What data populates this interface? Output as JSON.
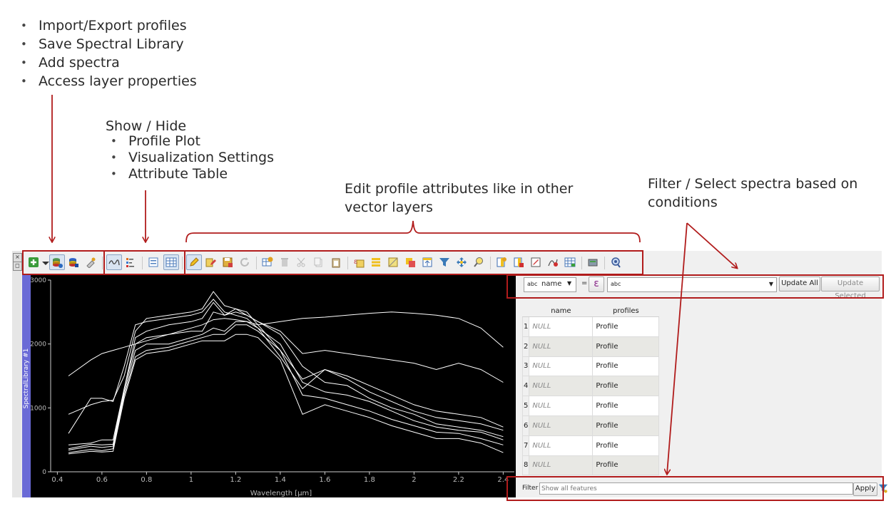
{
  "annotations": {
    "import_list": [
      "Import/Export profiles",
      "Save Spectral Library",
      "Add spectra",
      "Access layer properties"
    ],
    "show_hide_title": "Show / Hide",
    "show_hide_list": [
      "Profile Plot",
      "Visualization Settings",
      "Attribute Table"
    ],
    "edit_text": "Edit profile attributes like in other vector layers",
    "filter_text": "Filter / Select spectra based on conditions"
  },
  "plot": {
    "side_label": "SpectralLibrary #1",
    "xlabel": "Wavelength [µm]",
    "x_ticks": [
      "0.4",
      "0.6",
      "0.8",
      "1",
      "1.2",
      "1.4",
      "1.6",
      "1.8",
      "2",
      "2.2",
      "2.4"
    ],
    "y_ticks": [
      "3000",
      "2000",
      "1000",
      "0"
    ]
  },
  "chart_data": {
    "type": "line",
    "xlabel": "Wavelength [µm]",
    "xlim": [
      0.37,
      2.45
    ],
    "ylim": [
      0,
      3000
    ],
    "line_color": "#ffffff",
    "x": [
      0.45,
      0.55,
      0.6,
      0.65,
      0.7,
      0.75,
      0.8,
      0.9,
      1.0,
      1.05,
      1.1,
      1.15,
      1.2,
      1.25,
      1.3,
      1.4,
      1.5,
      1.6,
      1.7,
      1.8,
      1.9,
      2.0,
      2.1,
      2.2,
      2.3,
      2.4
    ],
    "series": [
      {
        "values": [
          1500,
          1750,
          1850,
          1900,
          1950,
          2000,
          2050,
          2150,
          2250,
          2300,
          2380,
          2400,
          2380,
          2350,
          2300,
          2350,
          2400,
          2420,
          2450,
          2480,
          2500,
          2480,
          2450,
          2400,
          2250,
          1950
        ]
      },
      {
        "values": [
          900,
          1050,
          1100,
          1120,
          1500,
          2200,
          2400,
          2450,
          2500,
          2550,
          2820,
          2600,
          2550,
          2450,
          2350,
          2200,
          1850,
          1900,
          1850,
          1800,
          1750,
          1700,
          1600,
          1700,
          1600,
          1400
        ]
      },
      {
        "values": [
          600,
          1150,
          1150,
          1100,
          1650,
          2300,
          2350,
          2400,
          2450,
          2500,
          2700,
          2500,
          2450,
          2400,
          2250,
          1800,
          1300,
          1600,
          1500,
          1350,
          1200,
          1050,
          950,
          900,
          850,
          700
        ]
      },
      {
        "values": [
          420,
          450,
          500,
          500,
          1300,
          2100,
          2200,
          2300,
          2350,
          2400,
          2650,
          2450,
          2550,
          2500,
          2300,
          1900,
          1450,
          1600,
          1450,
          1250,
          1100,
          950,
          850,
          800,
          750,
          650
        ]
      },
      {
        "values": [
          360,
          430,
          420,
          430,
          1300,
          2000,
          2100,
          2150,
          2200,
          2200,
          2500,
          2450,
          2500,
          2450,
          2350,
          2150,
          1650,
          1400,
          1350,
          1150,
          1000,
          900,
          750,
          700,
          650,
          550
        ]
      },
      {
        "values": [
          340,
          400,
          380,
          400,
          1250,
          1900,
          2000,
          2000,
          2100,
          2150,
          2250,
          2200,
          2350,
          2350,
          2250,
          2000,
          1400,
          1250,
          1200,
          1100,
          950,
          800,
          700,
          650,
          620,
          500
        ]
      },
      {
        "values": [
          300,
          350,
          330,
          360,
          1200,
          1800,
          1900,
          1950,
          2050,
          2100,
          2150,
          2150,
          2300,
          2300,
          2200,
          1900,
          1200,
          1150,
          1050,
          950,
          820,
          720,
          620,
          600,
          520,
          420
        ]
      },
      {
        "values": [
          280,
          320,
          310,
          320,
          1150,
          1750,
          1850,
          1900,
          2000,
          2050,
          2050,
          2050,
          2150,
          2150,
          2100,
          1750,
          900,
          1050,
          950,
          850,
          720,
          620,
          520,
          520,
          450,
          300
        ]
      }
    ]
  },
  "attribute": {
    "field_type": "abc",
    "field_name": "name",
    "equals": "=",
    "expr_icon": "ε",
    "value_type": "abc",
    "value": "",
    "update_all": "Update All",
    "update_selected": "Update Selected",
    "columns": [
      "name",
      "profiles"
    ],
    "rows": [
      {
        "n": "1",
        "name": "NULL",
        "profiles": "Profile"
      },
      {
        "n": "2",
        "name": "NULL",
        "profiles": "Profile"
      },
      {
        "n": "3",
        "name": "NULL",
        "profiles": "Profile"
      },
      {
        "n": "4",
        "name": "NULL",
        "profiles": "Profile"
      },
      {
        "n": "5",
        "name": "NULL",
        "profiles": "Profile"
      },
      {
        "n": "6",
        "name": "NULL",
        "profiles": "Profile"
      },
      {
        "n": "7",
        "name": "NULL",
        "profiles": "Profile"
      },
      {
        "n": "8",
        "name": "NULL",
        "profiles": "Profile"
      }
    ],
    "filter_label": "Filter",
    "filter_placeholder": "Show all features",
    "apply": "Apply"
  },
  "icons": [
    "add-layer-icon",
    "dropdown-arrow-icon",
    "import-export-icon",
    "save-library-icon",
    "add-spectra-icon",
    "layer-properties-icon",
    "profile-plot-icon",
    "visualization-settings-icon",
    "form-view-icon",
    "attribute-table-icon",
    "toggle-edit-icon",
    "multi-edit-icon",
    "save-edits-icon",
    "reload-icon",
    "add-feature-icon",
    "delete-feature-icon",
    "cut-icon",
    "copy-icon",
    "paste-icon",
    "select-by-expression-icon",
    "select-all-icon",
    "deselect-all-icon",
    "invert-selection-icon",
    "move-selection-top-icon",
    "filter-icon",
    "pan-to-selection-icon",
    "zoom-to-selection-icon",
    "new-field-icon",
    "delete-field-icon",
    "field-calculator-icon",
    "conditional-formatting-icon",
    "dock-icon",
    "actions-icon",
    "identify-icon"
  ]
}
